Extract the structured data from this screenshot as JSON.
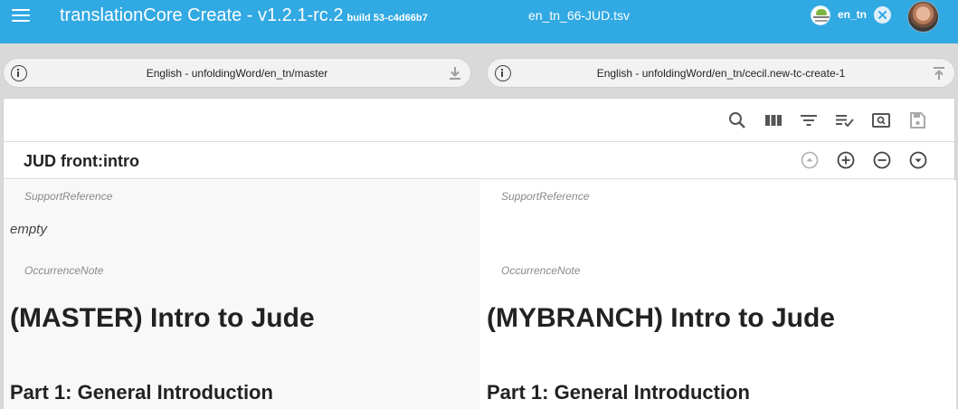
{
  "appbar": {
    "title": "translationCore Create - v1.2.1-rc.2",
    "build": "build 53-c4d66b7",
    "file_name": "en_tn_66-JUD.tsv",
    "org_name": "en_tn",
    "brand_color": "#31a9e3"
  },
  "resources": {
    "left": {
      "label": "English - unfoldingWord/en_tn/master",
      "action_icon": "download-icon"
    },
    "right": {
      "label": "English - unfoldingWord/en_tn/cecil.new-tc-create-1",
      "action_icon": "upload-icon"
    }
  },
  "toolbar": {
    "icons": [
      "search-icon",
      "view-columns-icon",
      "filter-icon",
      "playlist-check-icon",
      "preview-icon",
      "save-icon"
    ]
  },
  "row": {
    "reference": "JUD front:intro",
    "actions": [
      "move-up-icon",
      "add-row-icon",
      "delete-row-icon",
      "move-down-icon"
    ]
  },
  "columns": {
    "left": {
      "support_reference_label": "SupportReference",
      "support_reference_value": "empty",
      "occurrence_note_label": "OccurrenceNote",
      "heading": "(MASTER) Intro to Jude",
      "subheading": "Part 1: General Introduction"
    },
    "right": {
      "support_reference_label": "SupportReference",
      "occurrence_note_label": "OccurrenceNote",
      "heading": "(MYBRANCH) Intro to Jude",
      "subheading": "Part 1: General Introduction"
    }
  }
}
